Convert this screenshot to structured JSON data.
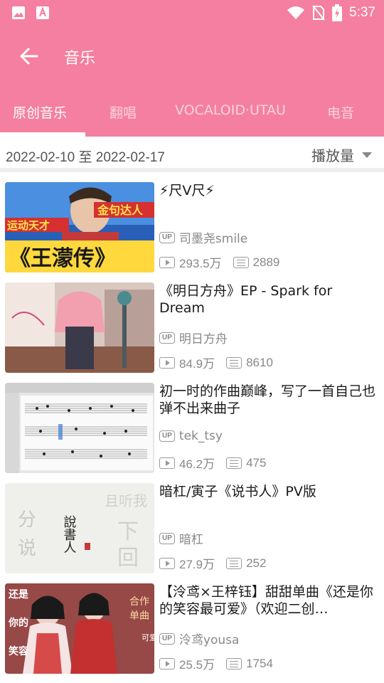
{
  "status": {
    "time": "5:37"
  },
  "header": {
    "title": "音乐"
  },
  "tabs": [
    {
      "label": "原创音乐",
      "active": true
    },
    {
      "label": "翻唱",
      "active": false
    },
    {
      "label": "VOCALOID·UTAU",
      "active": false
    },
    {
      "label": "电音",
      "active": false
    }
  ],
  "filter": {
    "date_range": "2022-02-10 至 2022-02-17",
    "sort_label": "播放量"
  },
  "videos": [
    {
      "title": "⚡尺V尺⚡",
      "up": "司墨尧smile",
      "plays": "293.5万",
      "danmaku": "2889",
      "thumb_text": "《王濛传》"
    },
    {
      "title": "《明日方舟》EP - Spark for Dream",
      "up": "明日方舟",
      "plays": "84.9万",
      "danmaku": "8610",
      "thumb_text": ""
    },
    {
      "title": "初一时的作曲巅峰，写了一首自己也弹不出来曲子",
      "up": "tek_tsy",
      "plays": "46.2万",
      "danmaku": "475",
      "thumb_text": ""
    },
    {
      "title": "暗杠/寅子《说书人》PV版",
      "up": "暗杠",
      "plays": "27.9万",
      "danmaku": "252",
      "thumb_text": "說書人"
    },
    {
      "title": "【泠鸢×王梓钰】甜甜单曲《还是你的笑容最可爱》（欢迎二创…",
      "up": "泠鸢yousa",
      "plays": "25.5万",
      "danmaku": "1754",
      "thumb_text": "还是你的笑容最可爱"
    }
  ],
  "up_badge": "UP",
  "colors": {
    "accent": "#f57fa0"
  }
}
